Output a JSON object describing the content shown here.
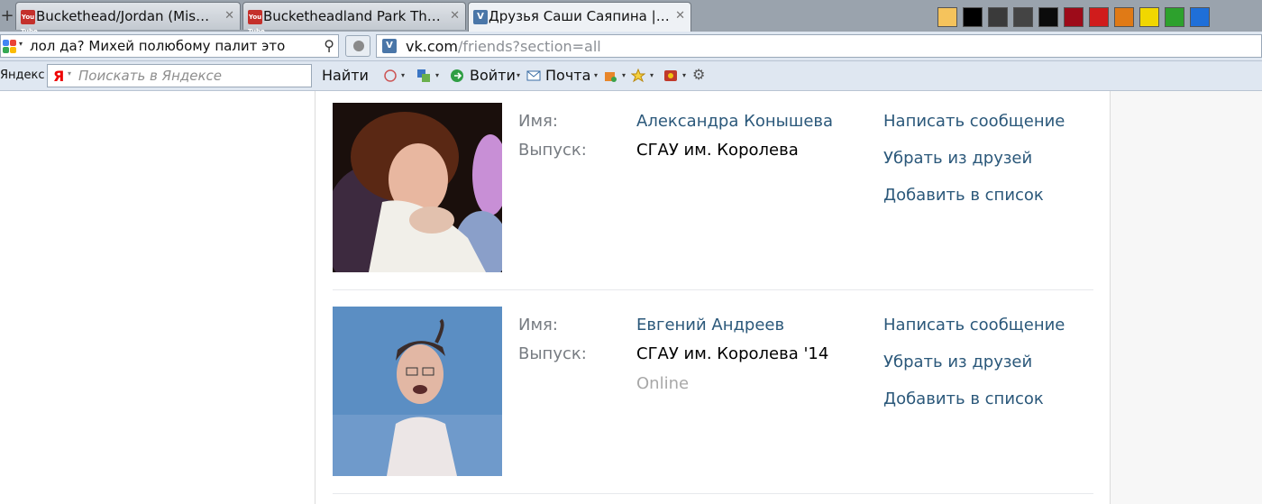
{
  "browser": {
    "tabs": [
      {
        "title": "Buckethead/Jordan (Mis…",
        "favicon": "youtube-icon"
      },
      {
        "title": "Bucketheadland Park Th…",
        "favicon": "youtube-icon"
      },
      {
        "title": "Друзья Саши Саяпина |…",
        "favicon": "vk-icon",
        "active": true
      }
    ],
    "favicon_labels": {
      "youtube": "You Tube",
      "vk": "V"
    },
    "palette_colors": [
      "#f5c35c",
      "#000000",
      "#3a3a3a",
      "#444444",
      "#0b0b0b",
      "#9d0b19",
      "#d01c1c",
      "#e07a16",
      "#f1d700",
      "#2da12d",
      "#1f6fd8"
    ],
    "search_box_text": "лол да? Михей полюбому палит это",
    "url_host": "vk.com",
    "url_path": "/friends?section=all"
  },
  "yandex_bar": {
    "label": "Яндекс",
    "logo": "Я",
    "placeholder": "Поискать в Яндексе",
    "find_button": "Найти",
    "login_label": "Войти",
    "mail_label": "Почта"
  },
  "friends": [
    {
      "name_label": "Имя:",
      "name": "Александра Конышева",
      "grad_label": "Выпуск:",
      "grad": "СГАУ им. Королева",
      "status": "",
      "actions": [
        "Написать сообщение",
        "Убрать из друзей",
        "Добавить в список"
      ]
    },
    {
      "name_label": "Имя:",
      "name": "Евгений Андреев",
      "grad_label": "Выпуск:",
      "grad": "СГАУ им. Королева '14",
      "status": "Online",
      "actions": [
        "Написать сообщение",
        "Убрать из друзей",
        "Добавить в список"
      ]
    }
  ],
  "colors": {
    "link": "#2b587a",
    "label": "#777c82",
    "online": "#a8a8a8"
  }
}
